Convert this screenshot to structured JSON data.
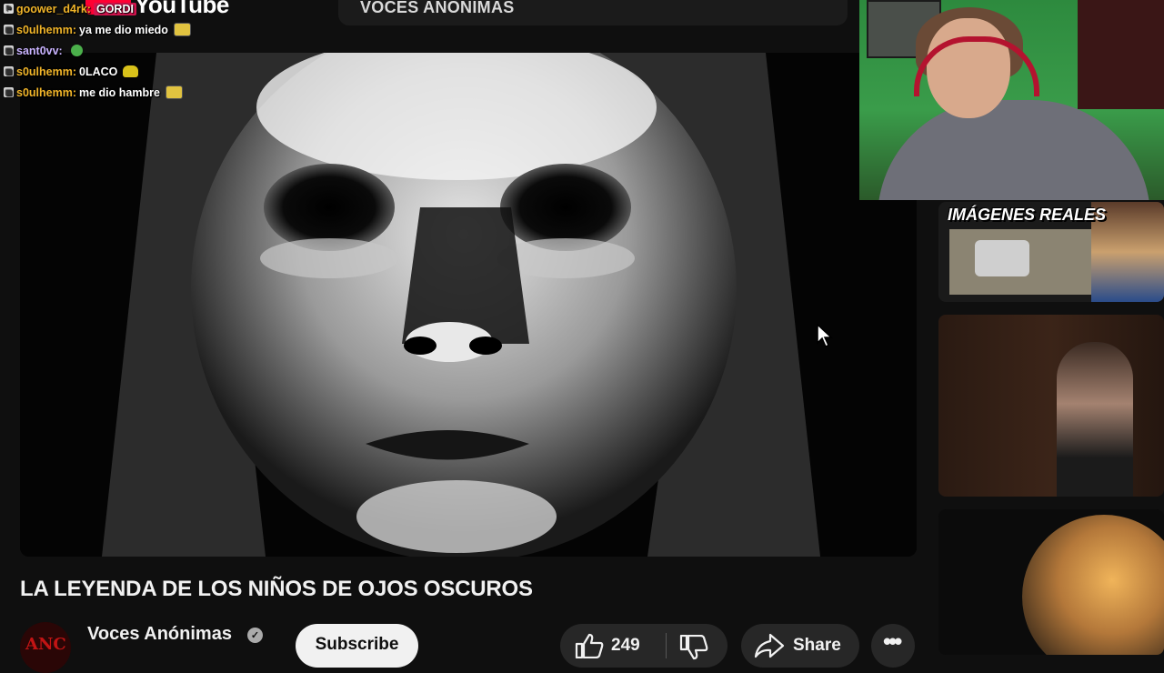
{
  "browser": {
    "logo_text": "YouTube",
    "tab_title": "VOCES ANÓNIMAS"
  },
  "chat": [
    {
      "user": "goower_d4rk:",
      "message": "GORDI",
      "highlight": true,
      "user_color": "#f0b429",
      "emote": ""
    },
    {
      "user": "s0ulhemm:",
      "message": "ya me dio miedo",
      "highlight": false,
      "user_color": "#f0b429",
      "emote": "face-emote"
    },
    {
      "user": "sant0vv:",
      "message": "",
      "highlight": false,
      "user_color": "#c9b3ff",
      "emote": "frog-emote"
    },
    {
      "user": "s0ulhemm:",
      "message": "0LACO",
      "highlight": false,
      "user_color": "#f0b429",
      "emote": "car-emote"
    },
    {
      "user": "s0ulhemm:",
      "message": "me dio hambre",
      "highlight": false,
      "user_color": "#f0b429",
      "emote": "face-emote"
    }
  ],
  "video": {
    "title": "LA LEYENDA DE LOS NIÑOS DE OJOS OSCUROS",
    "channel": {
      "name": "Voces Anónimas",
      "avatar_text": "ANC",
      "verified": true
    },
    "subscribe_label": "Subscribe",
    "like_count": "249",
    "share_label": "Share",
    "more_label": "•••"
  },
  "sidebar_thumbnails": [
    {
      "overlay_text": "IMÁGENES REALES"
    },
    {
      "overlay_text": ""
    },
    {
      "overlay_text": ""
    }
  ],
  "colors": {
    "background": "#0f0f0f",
    "pill_button": "#272727",
    "subscribe_bg": "#f1f1f1",
    "chat_highlight": "#d4144f",
    "brand_red": "#ff0033"
  }
}
